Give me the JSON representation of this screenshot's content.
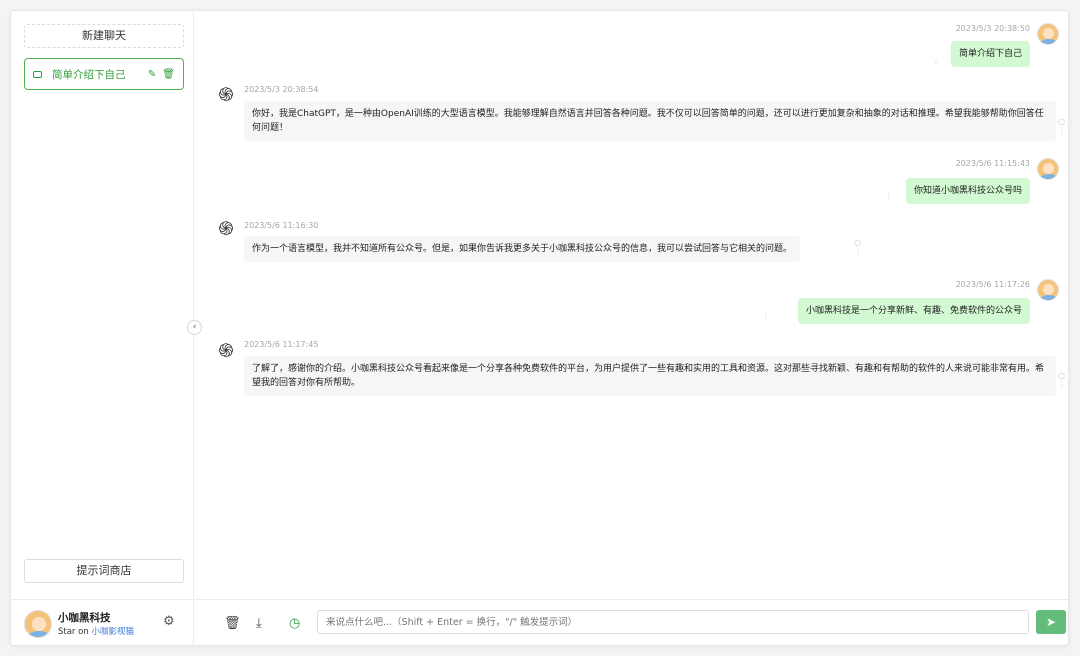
{
  "sidebar": {
    "new_chat_label": "新建聊天",
    "conversations": [
      {
        "title": "简单介绍下自己"
      }
    ],
    "prompt_store_label": "提示词商店",
    "user": {
      "name": "小咖黑科技",
      "sub_prefix": "Star on ",
      "sub_link": "小咖影视猫"
    }
  },
  "messages": [
    {
      "role": "user",
      "time": "2023/5/3 20:38:50",
      "text": "简单介绍下自己"
    },
    {
      "role": "assistant",
      "time": "2023/5/3 20:38:54",
      "text": "你好，我是ChatGPT，是一种由OpenAI训练的大型语言模型。我能够理解自然语言并回答各种问题。我不仅可以回答简单的问题，还可以进行更加复杂和抽象的对话和推理。希望我能够帮助你回答任何问题！"
    },
    {
      "role": "user",
      "time": "2023/5/6 11:15:43",
      "text": "你知道小咖黑科技公众号吗"
    },
    {
      "role": "assistant",
      "time": "2023/5/6 11:16:30",
      "text": "作为一个语言模型，我并不知道所有公众号。但是，如果你告诉我更多关于小咖黑科技公众号的信息，我可以尝试回答与它相关的问题。"
    },
    {
      "role": "user",
      "time": "2023/5/6 11:17:26",
      "text": "小咖黑科技是一个分享新鲜、有趣、免费软件的公众号"
    },
    {
      "role": "assistant",
      "time": "2023/5/6 11:17:45",
      "text": "了解了，感谢你的介绍。小咖黑科技公众号看起来像是一个分享各种免费软件的平台，为用户提供了一些有趣和实用的工具和资源。这对那些寻找新颖、有趣和有帮助的软件的人来说可能非常有用。希望我的回答对你有所帮助。"
    }
  ],
  "input": {
    "placeholder": "来说点什么吧...（Shift + Enter = 换行，\"/\" 触发提示词）"
  },
  "colors": {
    "accent": "#4caf50",
    "user_bubble": "#d2f9d1",
    "bot_bubble": "#f4f6f8",
    "send_button": "#63bd7a"
  }
}
